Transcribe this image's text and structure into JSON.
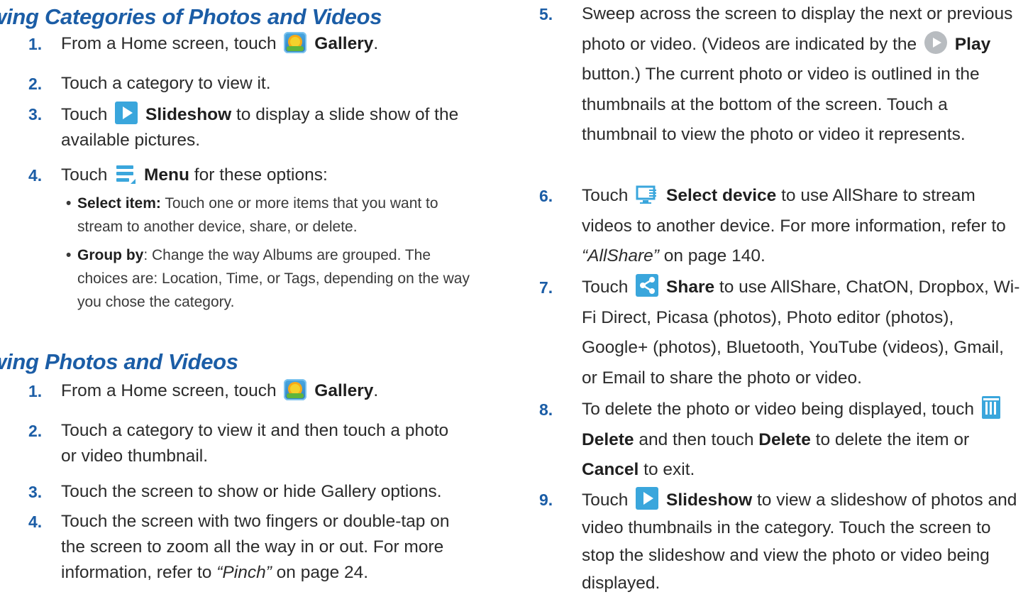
{
  "section1": {
    "heading": "iewing Categories of Photos and Videos",
    "steps": [
      {
        "num": "1.",
        "pre": "From a Home screen, touch",
        "bold": "Gallery",
        "post": "."
      },
      {
        "num": "2.",
        "text": "Touch a category to view it."
      },
      {
        "num": "3.",
        "pre": "Touch",
        "bold": "Slideshow",
        "post": "to display a slide show of the available pictures."
      },
      {
        "num": "4.",
        "pre": "Touch",
        "bold": "Menu",
        "post": "for these options:"
      }
    ],
    "bullets": [
      {
        "bold": "Select item:",
        "text": "Touch one or more items that you want to stream to another device, share, or delete."
      },
      {
        "bold": "Group by",
        "text": ": Change the way Albums are grouped. The choices are: Location, Time, or Tags, depending on the way you chose the category."
      }
    ]
  },
  "section2": {
    "heading": "iewing Photos and Videos",
    "steps": [
      {
        "num": "1.",
        "pre": "From a Home screen, touch",
        "bold": "Gallery",
        "post": "."
      },
      {
        "num": "2.",
        "text": "Touch a category to view it and then touch a photo or video thumbnail."
      },
      {
        "num": "3.",
        "text": "Touch the screen to show or hide Gallery options."
      },
      {
        "num": "4.",
        "pre": "Touch the screen with two fingers or double-tap on the screen to zoom all the way in or out. For more information, refer to",
        "ref": "“Pinch”",
        "post": " on page 24."
      }
    ]
  },
  "right": {
    "steps": [
      {
        "num": "5.",
        "pre": "Sweep across the screen to display the next or previous photo or video. (Videos are indicated by the",
        "bold": "Play",
        "post": "button.) The current photo or video is outlined in the thumbnails at the bottom of the screen. Touch a thumbnail to view the photo or video it represents."
      },
      {
        "num": "6.",
        "pre": "Touch",
        "bold": "Select device",
        "post": "to use AllShare to stream videos to another device. For more information, refer to",
        "ref": "“AllShare”",
        "post2": " on page 140."
      },
      {
        "num": "7.",
        "pre": "Touch",
        "bold": "Share",
        "post": "to use AllShare, ChatON, Dropbox, Wi-Fi Direct, Picasa (photos), Photo editor (photos), Google+ (photos), Bluetooth, YouTube (videos), Gmail, or Email to share the photo or video."
      },
      {
        "num": "8.",
        "pre": "To delete the photo or video being displayed, touch",
        "bold": "Delete",
        "mid": "and then touch",
        "bold2": "Delete",
        "mid2": "to delete the item or",
        "bold3": "Cancel",
        "post": "to exit."
      },
      {
        "num": "9.",
        "pre": "Touch",
        "bold": "Slideshow",
        "post": "to view a slideshow of photos and video thumbnails in the category. Touch the screen to stop the slideshow and view the photo or video being displayed."
      }
    ]
  }
}
